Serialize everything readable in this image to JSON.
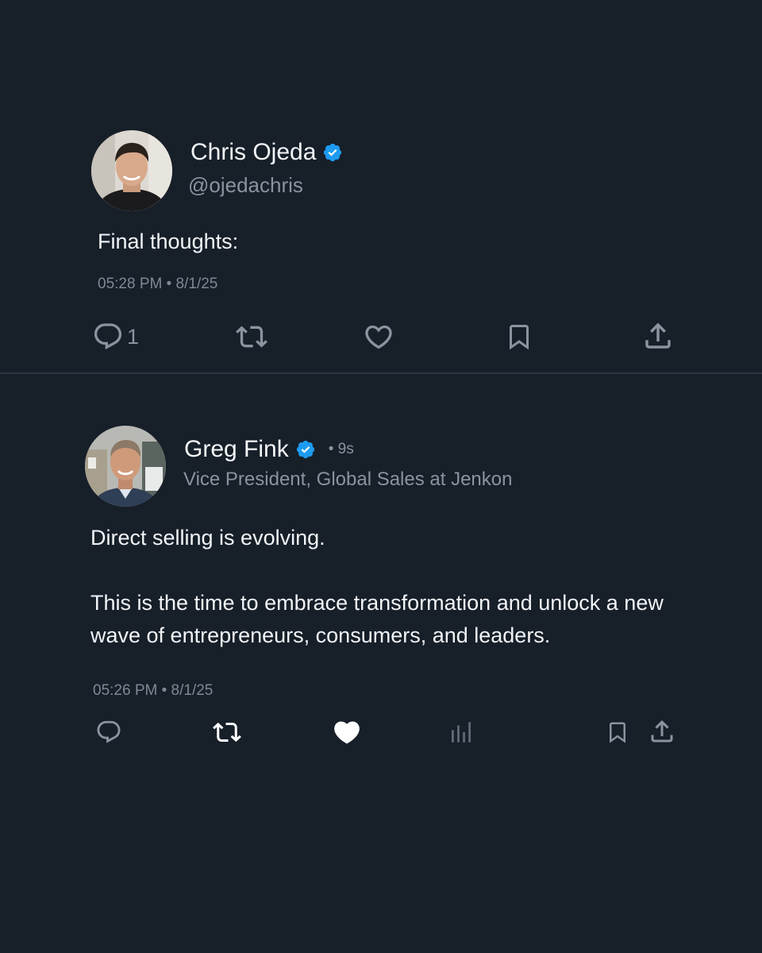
{
  "tweets": [
    {
      "author": {
        "name": "Chris Ojeda",
        "handle": "@ojedachris",
        "verified": true
      },
      "text": "Final thoughts:",
      "timestamp": "05:28 PM • 8/1/25",
      "actions": {
        "reply_icon": "reply-icon",
        "reply_count": "1",
        "retweet_icon": "retweet-icon",
        "like_icon": "heart-outline-icon",
        "bookmark_icon": "bookmark-icon",
        "share_icon": "share-icon"
      }
    },
    {
      "author": {
        "name": "Greg Fink",
        "verified": true,
        "time_ago": "• 9s",
        "title": "Vice President, Global Sales at Jenkon"
      },
      "text_paragraphs": [
        "Direct selling is evolving.",
        "This is the time to embrace transformation and unlock a new wave of entrepreneurs, consumers, and leaders."
      ],
      "timestamp": "05:26 PM • 8/1/25",
      "actions": {
        "reply_icon": "reply-icon",
        "retweet_icon": "retweet-icon",
        "like_icon": "heart-filled-icon",
        "views_icon": "analytics-icon",
        "bookmark_icon": "bookmark-icon",
        "share_icon": "share-icon"
      }
    }
  ],
  "colors": {
    "background": "#171f29",
    "verified": "#1d9bf0",
    "muted": "#8a949e",
    "divider": "#2c3641"
  }
}
